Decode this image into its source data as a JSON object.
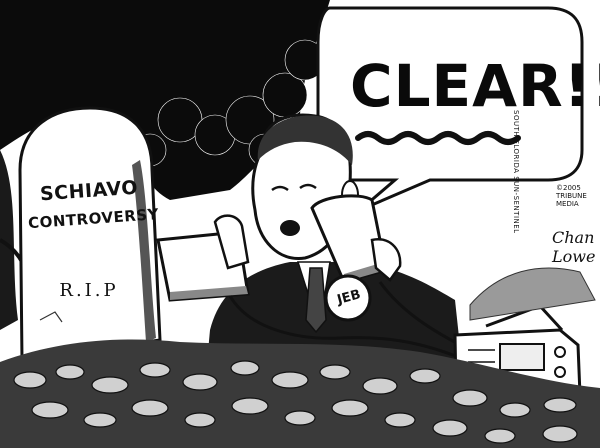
{
  "tombstone": {
    "line1": "SCHIAVO",
    "line2": "CONTROVERSY",
    "rip": "R.I.P"
  },
  "speech_bubble": {
    "text": "CLEAR!!"
  },
  "badge": {
    "text": "JEB"
  },
  "credits": {
    "publication": "SOUTH FLORIDA SUN-SENTINEL",
    "copyright": "©2005 TRIBUNE MEDIA",
    "signature": "Chan Lowe"
  },
  "colors": {
    "ink": "#111111",
    "paper": "#ffffff",
    "night": "#0b0b0b"
  }
}
